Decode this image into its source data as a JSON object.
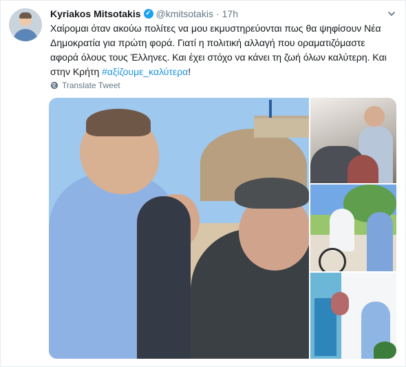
{
  "tweet": {
    "author_name": "Kyriakos Mitsotakis",
    "verified_badge": "✓",
    "handle": "@kmitsotakis",
    "separator": "·",
    "time": "17h",
    "text": {
      "line1": "Χαίρομαι όταν ακούω πολίτες να μου εκμυστηρεύονται πως θα ψηφίσουν Νέα",
      "line2": "Δημοκρατία για πρώτη φορά. Γιατί η πολιτική αλλαγή που οραματιζόμαστε",
      "line3": "αφορά όλους τους Έλληνες. Και έχει στόχο να κάνει τη ζωή όλων καλύτερη. Και",
      "line4_prefix": "στην Κρήτη ",
      "hashtag": "#αξίζουμε_καλύτερα",
      "suffix": "!"
    },
    "translate_label": "Translate Tweet"
  },
  "icons": {
    "verified": "verified-badge-icon",
    "menu": "chevron-down-icon",
    "translate": "globe-icon"
  },
  "colors": {
    "link": "#1b95e0",
    "verified": "#1da1f2",
    "secondary_text": "#657786",
    "border": "#e6ecf0"
  }
}
